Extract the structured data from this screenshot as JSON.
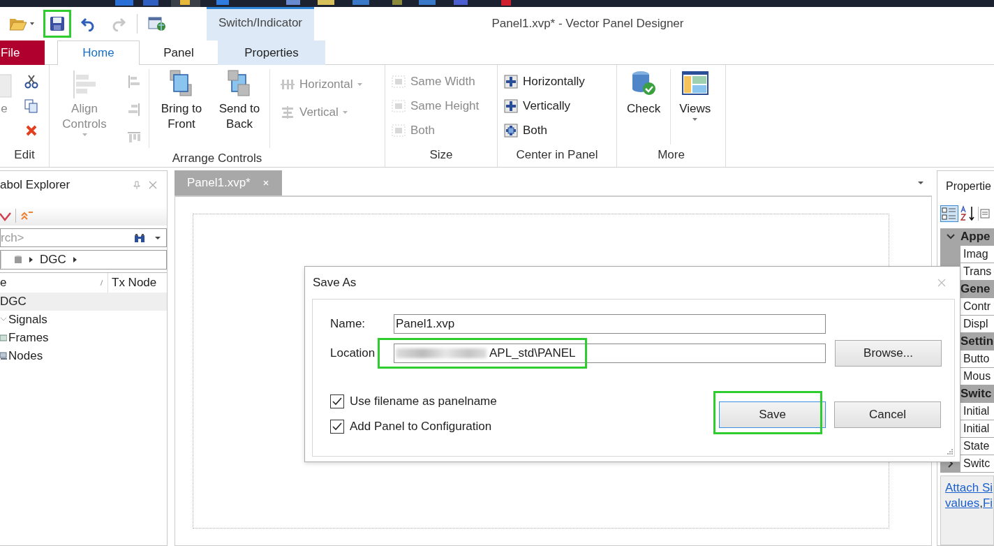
{
  "quick_access": [
    {
      "kind": "open",
      "dropdown": true,
      "disabled": false,
      "highlighted": false
    },
    {
      "kind": "save",
      "dropdown": false,
      "disabled": false,
      "highlighted": true
    },
    {
      "kind": "undo",
      "dropdown": false,
      "disabled": false,
      "highlighted": false
    },
    {
      "kind": "redo",
      "dropdown": false,
      "disabled": true,
      "highlighted": false
    },
    {
      "kind": "panel",
      "dropdown": false,
      "disabled": false,
      "highlighted": false
    }
  ],
  "window": {
    "title": "Panel1.xvp* - Vector Panel Designer"
  },
  "contextual_group": {
    "label": "Switch/Indicator"
  },
  "tabs": [
    {
      "label": "File",
      "kind": "file",
      "selected": false
    },
    {
      "label": "Home",
      "kind": "normal",
      "selected": true
    },
    {
      "label": "Panel",
      "kind": "normal",
      "selected": false
    },
    {
      "label": "Properties",
      "kind": "contextual",
      "selected": false
    }
  ],
  "ribbon": [
    {
      "label": "Edit",
      "columns": [
        [
          {
            "kind": "paste",
            "label": "e",
            "disabled": true,
            "dropdown": false
          }
        ],
        [
          {
            "kind": "cut",
            "disabled": false,
            "dropdown": false
          },
          {
            "kind": "copy",
            "disabled": false,
            "dropdown": false
          },
          {
            "kind": "delete",
            "disabled": false,
            "dropdown": false
          }
        ]
      ]
    },
    {
      "label": "Arrange Controls",
      "columns": [
        [
          {
            "kind": "align",
            "label": "Align Controls",
            "disabled": true,
            "dropdown": true
          }
        ],
        [
          {
            "kind": "align-left",
            "disabled": true,
            "dropdown": false
          },
          {
            "kind": "align-right",
            "disabled": true,
            "dropdown": false
          },
          {
            "kind": "align-top",
            "disabled": true,
            "dropdown": false
          }
        ],
        [
          {
            "kind": "front",
            "label": "Bring to Front",
            "disabled": false,
            "dropdown": false
          }
        ],
        [
          {
            "kind": "back",
            "label": "Send to Back",
            "disabled": false,
            "dropdown": false
          }
        ],
        [
          {
            "kind": "space-h",
            "label": "Horizontal",
            "disabled": true,
            "dropdown": true
          },
          {
            "kind": "space-v",
            "label": "Vertical",
            "disabled": true,
            "dropdown": true
          }
        ]
      ]
    },
    {
      "label": "Size",
      "columns": [
        [
          {
            "kind": "same-width",
            "label": "Same Width",
            "disabled": true,
            "dropdown": false
          },
          {
            "kind": "same-height",
            "label": "Same Height",
            "disabled": true,
            "dropdown": false
          },
          {
            "kind": "same-both",
            "label": "Both",
            "disabled": true,
            "dropdown": false
          }
        ]
      ]
    },
    {
      "label": "Center in Panel",
      "columns": [
        [
          {
            "kind": "center-h",
            "label": "Horizontally",
            "disabled": false,
            "dropdown": false
          },
          {
            "kind": "center-v",
            "label": "Vertically",
            "disabled": false,
            "dropdown": false
          },
          {
            "kind": "center-both",
            "label": "Both",
            "disabled": false,
            "dropdown": false
          }
        ]
      ]
    },
    {
      "label": "More",
      "columns": [
        [
          {
            "kind": "check",
            "label": "Check",
            "disabled": false,
            "dropdown": false
          }
        ],
        [
          {
            "kind": "views",
            "label": "Views",
            "disabled": false,
            "dropdown": true
          }
        ]
      ]
    }
  ],
  "symbol_explorer": {
    "title": "abol Explorer",
    "search": {
      "placeholder": "rch>"
    },
    "breadcrumb": "DGC",
    "columns": [
      "e",
      "Tx Node"
    ],
    "tree": [
      {
        "label": "DGC",
        "selected": true,
        "children": [
          {
            "label": "Signals",
            "kind": "group",
            "selected": false
          },
          {
            "label": "Frames",
            "kind": "frames",
            "selected": false
          },
          {
            "label": "Nodes",
            "kind": "nodes",
            "selected": false
          }
        ]
      }
    ]
  },
  "document_tabs": [
    {
      "label": "Panel1.xvp*",
      "selected": true
    }
  ],
  "properties": {
    "title": "Propertie",
    "categories": [
      {
        "name": "Appe",
        "rows": [
          {
            "name": "Imag",
            "expandable": false
          },
          {
            "name": "Trans",
            "expandable": false
          }
        ]
      },
      {
        "name": "Gene",
        "rows": [
          {
            "name": "Contr",
            "expandable": false
          },
          {
            "name": "Displ",
            "expandable": false
          }
        ]
      },
      {
        "name": "Settin",
        "rows": [
          {
            "name": "Butto",
            "expandable": false
          },
          {
            "name": "Mous",
            "expandable": false
          }
        ]
      },
      {
        "name": "Switc",
        "rows": [
          {
            "name": "Initial",
            "expandable": false
          },
          {
            "name": "Initial",
            "expandable": false
          },
          {
            "name": "State",
            "expandable": false
          },
          {
            "name": "Switc",
            "expandable": true
          }
        ]
      }
    ],
    "description": [
      [
        {
          "text": "Attach Si",
          "kind": "link"
        }
      ],
      [
        {
          "text": "values",
          "kind": "link"
        },
        {
          "text": ",",
          "kind": "text"
        },
        {
          "text": "Fi",
          "kind": "link"
        }
      ]
    ]
  },
  "dialog": {
    "title": "Save As",
    "name_label": "Name:",
    "name_value": "Panel1.xvp",
    "location_label": "Location",
    "location_value": "APL_std\\PANEL",
    "location_blurred_prefix": true,
    "location_highlighted": true,
    "checkboxes": [
      {
        "label": "Use filename as panelname",
        "checked": true
      },
      {
        "label": "Add Panel to Configuration",
        "checked": true
      }
    ],
    "browse_button": {
      "label": "Browse..."
    },
    "buttons": [
      {
        "label": "Save",
        "default": true,
        "highlighted": true
      },
      {
        "label": "Cancel",
        "default": false,
        "highlighted": false
      }
    ]
  }
}
